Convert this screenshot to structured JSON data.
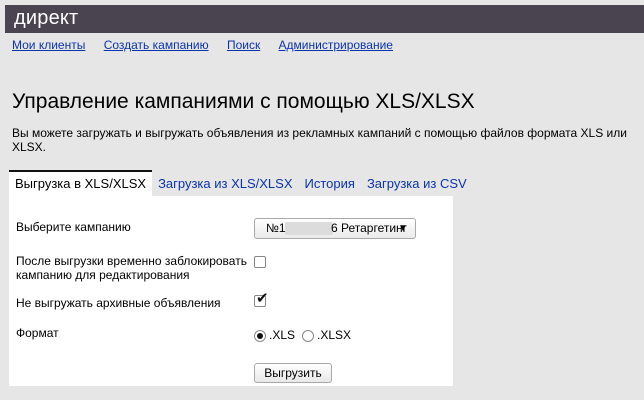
{
  "header": {
    "logo": "директ",
    "background": "#4a4450"
  },
  "nav": {
    "items": [
      "Мои клиенты",
      "Создать кампанию",
      "Поиск",
      "Администрирование"
    ]
  },
  "page": {
    "title": "Управление кампаниями с помощью XLS/XLSX",
    "description": "Вы можете загружать и выгружать объявления из рекламных кампаний с помощью файлов формата XLS или XLSX."
  },
  "tabs": {
    "items": [
      "Выгрузка в XLS/XLSX",
      "Загрузка из XLS/XLSX",
      "История",
      "Загрузка из CSV"
    ],
    "active": 0
  },
  "form": {
    "campaign_label": "Выберите кампанию",
    "campaign_value_prefix": "№1",
    "campaign_value_suffix": "6 Ретаргетинг",
    "lock_label": "После выгрузки временно заблокировать кампанию для редактирования",
    "lock_checked": false,
    "archive_label": "Не выгружать архивные объявления",
    "archive_checked": true,
    "format_label": "Формат",
    "format_options": [
      ".XLS",
      ".XLSX"
    ],
    "format_selected": ".XLS",
    "export_button": "Выгрузить"
  },
  "colors": {
    "link": "#0b34ab",
    "page_bg": "#e6e6e6",
    "panel_bg": "#ffffff"
  }
}
